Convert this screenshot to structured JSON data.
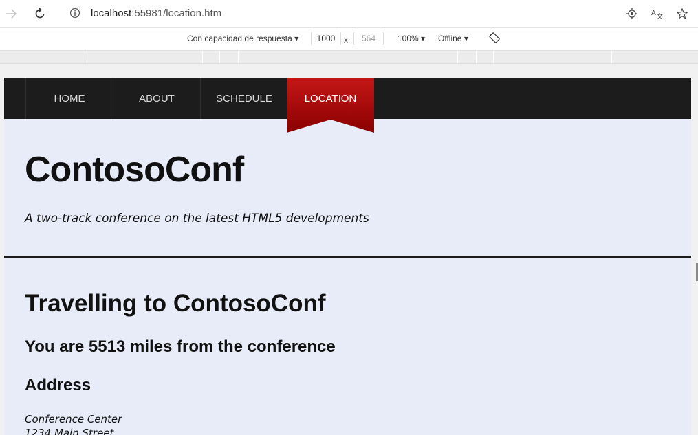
{
  "browser": {
    "url_host": "localhost",
    "url_rest": ":55981/location.htm"
  },
  "devtools": {
    "responsive_label": "Con capacidad de respuesta",
    "width": "1000",
    "x_label": "x",
    "height": "564",
    "zoom": "100%",
    "network": "Offline"
  },
  "nav": {
    "items": [
      {
        "label": "HOME"
      },
      {
        "label": "ABOUT"
      },
      {
        "label": "SCHEDULE"
      },
      {
        "label": "LOCATION"
      }
    ],
    "active_color": "#9b0000"
  },
  "header": {
    "title": "ContosoConf",
    "tagline": "A two-track conference on the latest HTML5 developments"
  },
  "main": {
    "heading": "Travelling to ContosoConf",
    "distance": "You are 5513 miles from the conference",
    "address_heading": "Address",
    "address_lines": [
      "Conference Center",
      "1234 Main Street"
    ]
  }
}
